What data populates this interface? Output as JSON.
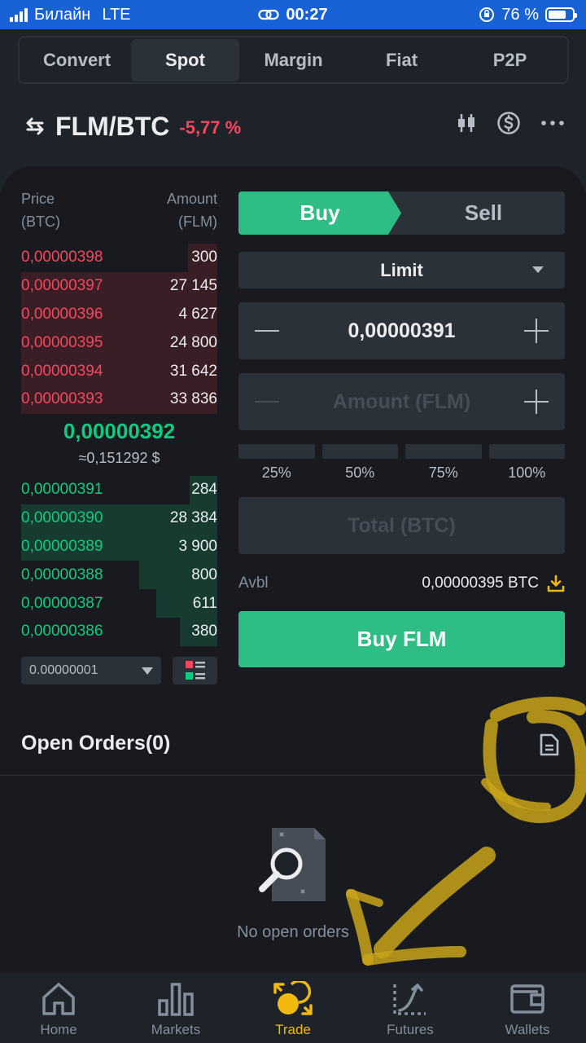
{
  "status_bar": {
    "carrier": "Билайн",
    "network": "LTE",
    "time": "00:27",
    "battery": "76 %",
    "battery_level": 0.76
  },
  "mode_tabs": [
    {
      "label": "Convert",
      "active": false
    },
    {
      "label": "Spot",
      "active": true
    },
    {
      "label": "Margin",
      "active": false
    },
    {
      "label": "Fiat",
      "active": false
    },
    {
      "label": "P2P",
      "active": false
    }
  ],
  "pair": {
    "name": "FLM/BTC",
    "change": "-5,77 %",
    "icons": [
      "candlestick-chart-icon",
      "dollar-coin-icon",
      "more-dots-icon"
    ]
  },
  "order_book": {
    "price_header": [
      "Price",
      "(BTC)"
    ],
    "amount_header": [
      "Amount",
      "(FLM)"
    ],
    "asks": [
      {
        "price": "0,00000398",
        "amount": "300",
        "depth": 0.15
      },
      {
        "price": "0,00000397",
        "amount": "27 145",
        "depth": 1.0
      },
      {
        "price": "0,00000396",
        "amount": "4 627",
        "depth": 1.0
      },
      {
        "price": "0,00000395",
        "amount": "24 800",
        "depth": 1.0
      },
      {
        "price": "0,00000394",
        "amount": "31 642",
        "depth": 1.0
      },
      {
        "price": "0,00000393",
        "amount": "33 836",
        "depth": 1.0
      }
    ],
    "mid_price": "0,00000392",
    "mid_fiat": "≈0,151292 $",
    "bids": [
      {
        "price": "0,00000391",
        "amount": "284",
        "depth": 0.14
      },
      {
        "price": "0,00000390",
        "amount": "28 384",
        "depth": 1.0
      },
      {
        "price": "0,00000389",
        "amount": "3 900",
        "depth": 1.0
      },
      {
        "price": "0,00000388",
        "amount": "800",
        "depth": 0.4
      },
      {
        "price": "0,00000387",
        "amount": "611",
        "depth": 0.31
      },
      {
        "price": "0,00000386",
        "amount": "380",
        "depth": 0.19
      }
    ],
    "precision": "0.00000001"
  },
  "form": {
    "buy_label": "Buy",
    "sell_label": "Sell",
    "order_type": "Limit",
    "price_value": "0,00000391",
    "amount_placeholder": "Amount (FLM)",
    "percent_labels": [
      "25%",
      "50%",
      "75%",
      "100%"
    ],
    "total_placeholder": "Total (BTC)",
    "avbl_label": "Avbl",
    "avbl_value": "0,00000395 BTC",
    "submit_label": "Buy FLM"
  },
  "open_orders": {
    "title": "Open Orders(0)",
    "empty_text": "No open orders"
  },
  "bottom_nav": [
    {
      "label": "Home",
      "icon": "home-icon",
      "active": false
    },
    {
      "label": "Markets",
      "icon": "markets-icon",
      "active": false
    },
    {
      "label": "Trade",
      "icon": "trade-icon",
      "active": true
    },
    {
      "label": "Futures",
      "icon": "futures-icon",
      "active": false
    },
    {
      "label": "Wallets",
      "icon": "wallet-icon",
      "active": false
    }
  ],
  "colors": {
    "buy": "#2ebd85",
    "sell": "#f6465d",
    "accent": "#f0b90b",
    "status_bar": "#1862d6"
  }
}
